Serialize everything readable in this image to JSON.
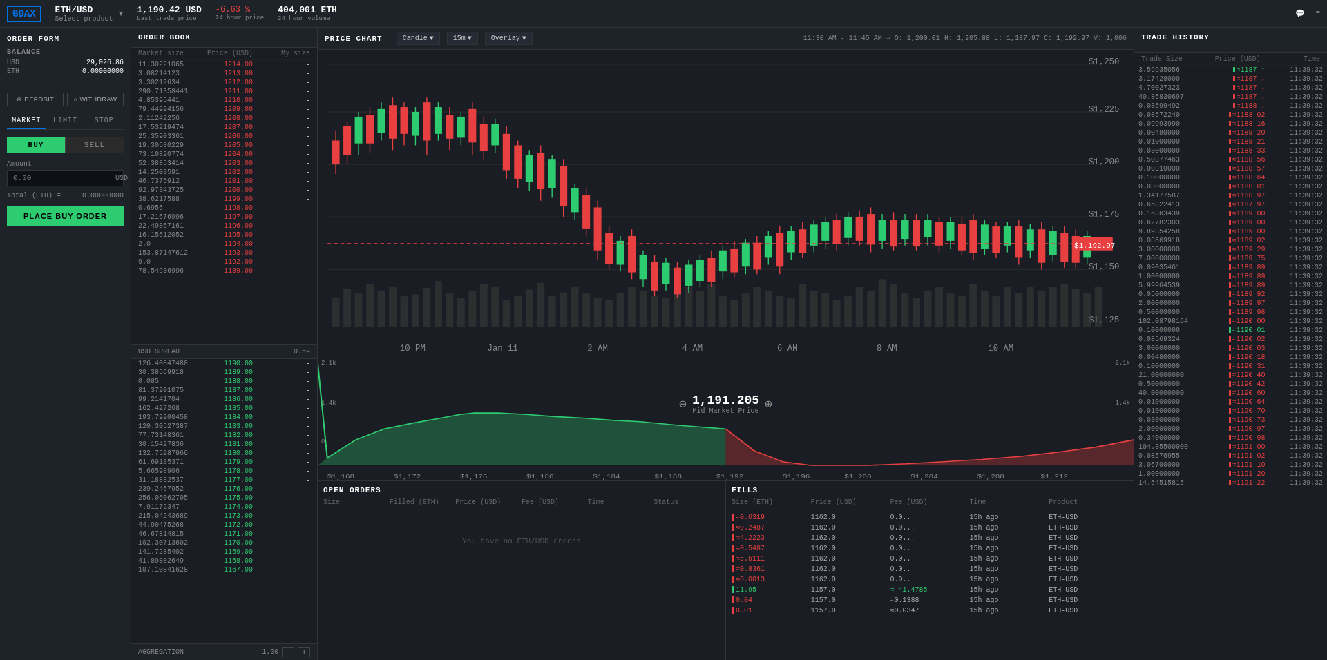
{
  "header": {
    "logo": "GDAX",
    "pair": "ETH/USD",
    "pair_sub": "Select product",
    "last_price": "1,190.42 USD",
    "last_price_label": "Last trade price",
    "change_24h": "-6.63 %",
    "change_24h_label": "24 hour price",
    "volume_24h": "404,001 ETH",
    "volume_24h_label": "24 hour volume"
  },
  "order_form": {
    "title": "ORDER FORM",
    "balance_label": "BALANCE",
    "usd_label": "USD",
    "usd_amount": "29,026.86",
    "eth_label": "ETH",
    "eth_amount": "0.00000000",
    "deposit_label": "DEPOSIT",
    "withdraw_label": "WITHDRAW",
    "tabs": [
      "MARKET",
      "LIMIT",
      "STOP"
    ],
    "active_tab": "MARKET",
    "buy_label": "BUY",
    "sell_label": "SELL",
    "amount_label": "Amount",
    "amount_placeholder": "0.00",
    "amount_suffix": "USD",
    "total_label": "Total (ETH) =",
    "total_value": "0.00000000",
    "place_order_label": "PLACE BUY ORDER"
  },
  "order_book": {
    "title": "ORDER BOOK",
    "col_market_size": "Market size",
    "col_price": "Price (USD)",
    "col_my_size": "My size",
    "asks": [
      {
        "size": "11.30221065",
        "price": "1214.00"
      },
      {
        "size": "3.08214123",
        "price": "1213.00"
      },
      {
        "size": "3.30212634",
        "price": "1212.00"
      },
      {
        "size": "290.71358441",
        "price": "1211.00"
      },
      {
        "size": "4.85395441",
        "price": "1210.00"
      },
      {
        "size": "79.44924156",
        "price": "1209.00"
      },
      {
        "size": "2.11242256",
        "price": "1208.00"
      },
      {
        "size": "17.53219474",
        "price": "1207.00"
      },
      {
        "size": "25.35903361",
        "price": "1206.00"
      },
      {
        "size": "19.30530229",
        "price": "1205.00"
      },
      {
        "size": "73.10820774",
        "price": "1204.00"
      },
      {
        "size": "52.38853414",
        "price": "1203.00"
      },
      {
        "size": "14.2503591",
        "price": "1202.00"
      },
      {
        "size": "46.7375912",
        "price": "1201.00"
      },
      {
        "size": "92.97343725",
        "price": "1200.00"
      },
      {
        "size": "38.6217588",
        "price": "1199.00"
      },
      {
        "size": "0.6956",
        "price": "1198.00"
      },
      {
        "size": "17.21676996",
        "price": "1197.00"
      },
      {
        "size": "22.49867161",
        "price": "1196.00"
      },
      {
        "size": "16.15512052",
        "price": "1195.00"
      },
      {
        "size": "2.0",
        "price": "1194.00"
      },
      {
        "size": "153.87147612",
        "price": "1193.00"
      },
      {
        "size": "9.0",
        "price": "1192.00"
      },
      {
        "size": "78.54936996",
        "price": "1189.00"
      }
    ],
    "spread_label": "USD SPREAD",
    "spread_value": "0.59",
    "bids": [
      {
        "size": "126.40847488",
        "price": "1190.00"
      },
      {
        "size": "30.38569918",
        "price": "1189.00"
      },
      {
        "size": "0.085",
        "price": "1188.00"
      },
      {
        "size": "81.37201075",
        "price": "1187.00"
      },
      {
        "size": "99.2141704",
        "price": "1186.00"
      },
      {
        "size": "162.427268",
        "price": "1185.00"
      },
      {
        "size": "193.79200458",
        "price": "1184.00"
      },
      {
        "size": "120.30527387",
        "price": "1183.00"
      },
      {
        "size": "77.73148361",
        "price": "1182.00"
      },
      {
        "size": "30.15427836",
        "price": "1181.00"
      },
      {
        "size": "132.75287966",
        "price": "1180.00"
      },
      {
        "size": "61.69185371",
        "price": "1179.00"
      },
      {
        "size": "5.66598906",
        "price": "1178.00"
      },
      {
        "size": "31.18832537",
        "price": "1177.00"
      },
      {
        "size": "239.2467952",
        "price": "1176.00"
      },
      {
        "size": "256.06062705",
        "price": "1175.00"
      },
      {
        "size": "7.91172347",
        "price": "1174.00"
      },
      {
        "size": "215.04243689",
        "price": "1173.00"
      },
      {
        "size": "44.90475268",
        "price": "1172.00"
      },
      {
        "size": "46.67814815",
        "price": "1171.00"
      },
      {
        "size": "102.30713602",
        "price": "1170.00"
      },
      {
        "size": "141.7285402",
        "price": "1169.00"
      },
      {
        "size": "41.89802649",
        "price": "1168.00"
      },
      {
        "size": "107.10841628",
        "price": "1167.00"
      }
    ],
    "aggregation_label": "AGGREGATION",
    "aggregation_value": "1.00"
  },
  "price_chart": {
    "title": "PRICE CHART",
    "chart_type": "Candle",
    "interval": "15m",
    "overlay": "Overlay",
    "ohlcv_label": "11:30 AM - 11:45 AM →",
    "open": "O: 1,200.01",
    "high": "H: 1,205.88",
    "low": "L: 1,187.97",
    "close": "C: 1,192.97",
    "volume": "V: 1,006",
    "mid_market_price": "1,191.205",
    "mid_market_label": "Mid Market Price",
    "price_tag": "$1,192.97",
    "y_labels": [
      "$1,250",
      "$1,225",
      "$1,200",
      "$1,175",
      "$1,150",
      "$1,125"
    ],
    "x_labels": [
      "10 PM",
      "Jan 11",
      "2 AM",
      "4 AM",
      "6 AM",
      "8 AM",
      "10 AM"
    ],
    "depth_left": "2.1k",
    "depth_right": "2.1k",
    "depth_left2": "1.4k",
    "depth_right2": "1.4k",
    "depth_x_labels": [
      "$1,168",
      "$1,172",
      "$1,176",
      "$1,180",
      "$1,184",
      "$1,188",
      "$1,192",
      "$1,196",
      "$1,200",
      "$1,204",
      "$1,208",
      "$1,212"
    ]
  },
  "open_orders": {
    "title": "OPEN ORDERS",
    "cols": [
      "Size",
      "Filled (ETH)",
      "Price (USD)",
      "Fee (USD)",
      "Time",
      "Status"
    ],
    "empty_message": "You have no ETH/USD orders"
  },
  "fills": {
    "title": "FILLS",
    "cols": [
      "Size (ETH)",
      "Price (USD)",
      "Fee (USD)",
      "Time",
      "Product"
    ],
    "rows": [
      {
        "size": "≈0.6319",
        "price": "1162.0",
        "fee": "0.0...",
        "time": "15h ago",
        "product": "ETH-USD",
        "color": "red"
      },
      {
        "size": "≈0.2487",
        "price": "1162.0",
        "fee": "0.0...",
        "time": "15h ago",
        "product": "ETH-USD",
        "color": "red"
      },
      {
        "size": "≈4.2223",
        "price": "1162.0",
        "fee": "0.0...",
        "time": "15h ago",
        "product": "ETH-USD",
        "color": "red"
      },
      {
        "size": "≈0.5487",
        "price": "1162.0",
        "fee": "0.0...",
        "time": "15h ago",
        "product": "ETH-USD",
        "color": "red"
      },
      {
        "size": "≈5.5111",
        "price": "1162.0",
        "fee": "0.0...",
        "time": "15h ago",
        "product": "ETH-USD",
        "color": "red"
      },
      {
        "size": "≈0.8361",
        "price": "1162.0",
        "fee": "0.0...",
        "time": "15h ago",
        "product": "ETH-USD",
        "color": "red"
      },
      {
        "size": "≈0.0013",
        "price": "1162.0",
        "fee": "0.0...",
        "time": "15h ago",
        "product": "ETH-USD",
        "color": "red"
      },
      {
        "size": "11.95",
        "price": "1157.0",
        "fee": "≈-41.4785",
        "time": "15h ago",
        "product": "ETH-USD",
        "color": "green"
      },
      {
        "size": "0.04",
        "price": "1157.0",
        "fee": "≈0.1388",
        "time": "15h ago",
        "product": "ETH-USD",
        "color": "red"
      },
      {
        "size": "0.01",
        "price": "1157.0",
        "fee": "≈0.0347",
        "time": "15h ago",
        "product": "ETH-USD",
        "color": "red"
      }
    ]
  },
  "trade_history": {
    "title": "TRADE HISTORY",
    "col_trade_size": "Trade Size",
    "col_price": "Price (USD)",
    "col_time": "Time",
    "rows": [
      {
        "size": "3.59935056",
        "price": "≈1187 ↑",
        "time": "11:39:32",
        "dir": "up"
      },
      {
        "size": "3.17428000",
        "price": "≈1187 ↓",
        "time": "11:39:32",
        "dir": "down"
      },
      {
        "size": "4.70027323",
        "price": "≈1187 ↓",
        "time": "11:39:32",
        "dir": "down"
      },
      {
        "size": "40.86830697",
        "price": "≈1187 ↓",
        "time": "11:39:32",
        "dir": "down"
      },
      {
        "size": "0.08599492",
        "price": "≈1188 ↓",
        "time": "11:39:32",
        "dir": "down"
      },
      {
        "size": "0.08572240",
        "price": "≈1188 02",
        "time": "11:39:32",
        "dir": "down"
      },
      {
        "size": "0.09993990",
        "price": "≈1188 16",
        "time": "11:39:32",
        "dir": "down"
      },
      {
        "size": "0.00480000",
        "price": "≈1188 20",
        "time": "11:39:32",
        "dir": "down"
      },
      {
        "size": "0.01000000",
        "price": "≈1188 21",
        "time": "11:39:32",
        "dir": "down"
      },
      {
        "size": "0.03000000",
        "price": "≈1188 33",
        "time": "11:39:32",
        "dir": "down"
      },
      {
        "size": "0.50877463",
        "price": "≈1188 56",
        "time": "11:39:32",
        "dir": "down"
      },
      {
        "size": "0.00310000",
        "price": "≈1188 57",
        "time": "11:39:32",
        "dir": "down"
      },
      {
        "size": "0.10000000",
        "price": "≈1188 64",
        "time": "11:39:32",
        "dir": "down"
      },
      {
        "size": "0.03000000",
        "price": "≈1188 81",
        "time": "11:39:32",
        "dir": "down"
      },
      {
        "size": "1.34177587",
        "price": "≈1188 97",
        "time": "11:39:32",
        "dir": "down"
      },
      {
        "size": "0.65822413",
        "price": "≈1187 97",
        "time": "11:39:32",
        "dir": "down"
      },
      {
        "size": "0.16363439",
        "price": "≈1189 00",
        "time": "11:39:32",
        "dir": "down"
      },
      {
        "size": "0.62782303",
        "price": "≈1189 00",
        "time": "11:39:32",
        "dir": "down"
      },
      {
        "size": "9.89854258",
        "price": "≈1189 00",
        "time": "11:39:32",
        "dir": "down"
      },
      {
        "size": "0.08569918",
        "price": "≈1189 02",
        "time": "11:39:32",
        "dir": "down"
      },
      {
        "size": "3.00000000",
        "price": "≈1189 29",
        "time": "11:39:32",
        "dir": "down"
      },
      {
        "size": "7.00000000",
        "price": "≈1189 75",
        "time": "11:39:32",
        "dir": "down"
      },
      {
        "size": "0.09035461",
        "price": "≈1189 89",
        "time": "11:39:32",
        "dir": "down"
      },
      {
        "size": "1.00000000",
        "price": "≈1189 89",
        "time": "11:39:32",
        "dir": "down"
      },
      {
        "size": "5.99964539",
        "price": "≈1189 89",
        "time": "11:39:32",
        "dir": "down"
      },
      {
        "size": "0.05000000",
        "price": "≈1189 92",
        "time": "11:39:32",
        "dir": "down"
      },
      {
        "size": "2.00000000",
        "price": "≈1189 97",
        "time": "11:39:32",
        "dir": "down"
      },
      {
        "size": "0.50000000",
        "price": "≈1189 98",
        "time": "11:39:32",
        "dir": "down"
      },
      {
        "size": "102.08798164",
        "price": "≈1190 00",
        "time": "11:39:32",
        "dir": "down"
      },
      {
        "size": "0.10000000",
        "price": "≈1190 01",
        "time": "11:39:32",
        "dir": "up"
      },
      {
        "size": "0.08569324",
        "price": "≈1190 02",
        "time": "11:39:32",
        "dir": "down"
      },
      {
        "size": "3.00000000",
        "price": "≈1190 03",
        "time": "11:39:32",
        "dir": "down"
      },
      {
        "size": "0.00480000",
        "price": "≈1190 18",
        "time": "11:39:32",
        "dir": "down"
      },
      {
        "size": "0.10000000",
        "price": "≈1190 31",
        "time": "11:39:32",
        "dir": "down"
      },
      {
        "size": "21.00000000",
        "price": "≈1190 40",
        "time": "11:39:32",
        "dir": "down"
      },
      {
        "size": "0.50000000",
        "price": "≈1190 42",
        "time": "11:39:32",
        "dir": "down"
      },
      {
        "size": "40.00000000",
        "price": "≈1190 60",
        "time": "11:39:32",
        "dir": "down"
      },
      {
        "size": "0.01000000",
        "price": "≈1190 64",
        "time": "11:39:32",
        "dir": "down"
      },
      {
        "size": "0.01000000",
        "price": "≈1190 70",
        "time": "11:39:32",
        "dir": "down"
      },
      {
        "size": "0.03000000",
        "price": "≈1190 73",
        "time": "11:39:32",
        "dir": "down"
      },
      {
        "size": "2.00000000",
        "price": "≈1190 97",
        "time": "11:39:32",
        "dir": "down"
      },
      {
        "size": "0.34000000",
        "price": "≈1190 98",
        "time": "11:39:32",
        "dir": "down"
      },
      {
        "size": "104.85500000",
        "price": "≈1191 00",
        "time": "11:39:32",
        "dir": "down"
      },
      {
        "size": "0.08576955",
        "price": "≈1191 02",
        "time": "11:39:32",
        "dir": "down"
      },
      {
        "size": "3.06700000",
        "price": "≈1191 10",
        "time": "11:39:32",
        "dir": "down"
      },
      {
        "size": "1.00000000",
        "price": "≈1191 20",
        "time": "11:39:32",
        "dir": "down"
      },
      {
        "size": "14.64515815",
        "price": "≈1191 22",
        "time": "11:39:32",
        "dir": "down"
      }
    ]
  }
}
